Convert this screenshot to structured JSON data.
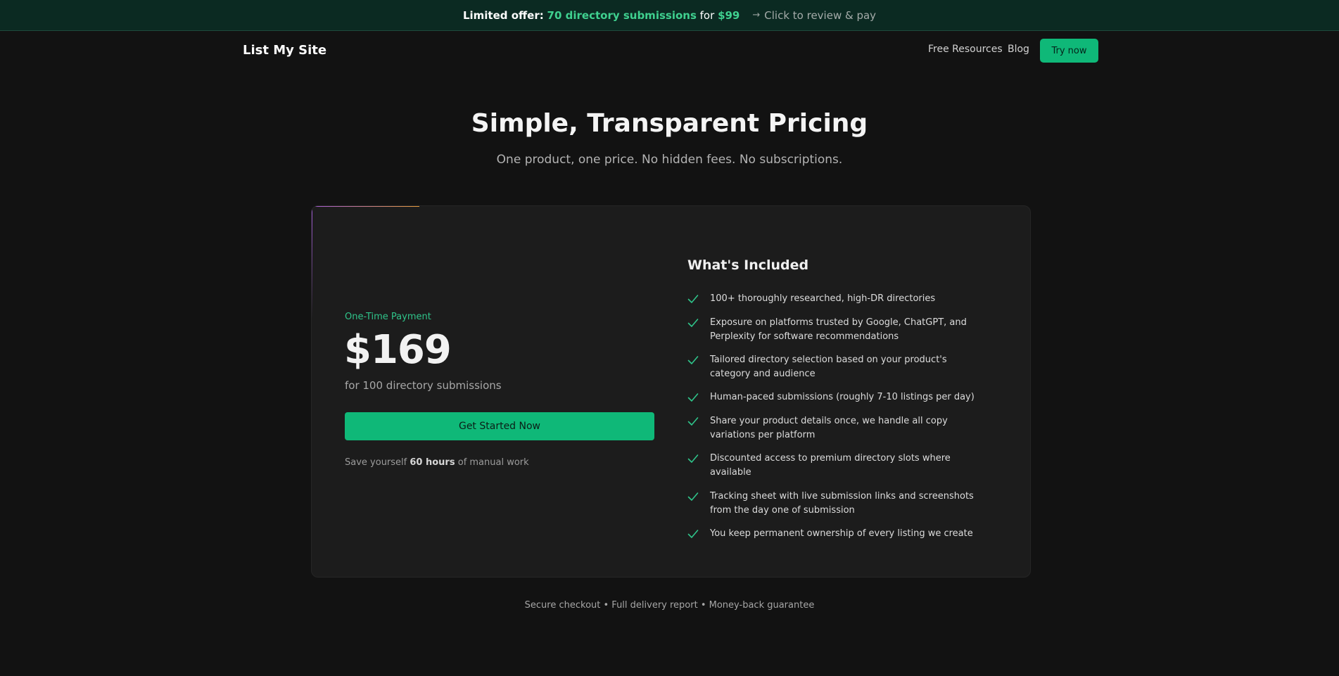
{
  "banner": {
    "prefix": "Limited offer:",
    "offer": "70 directory submissions",
    "for_word": "for",
    "price": "$99",
    "arrow": "→",
    "cta": "Click to review & pay"
  },
  "nav": {
    "logo": "List My Site",
    "links": [
      "Free Resources",
      "Blog"
    ],
    "cta": "Try now"
  },
  "hero": {
    "title": "Simple, Transparent Pricing",
    "subtitle": "One product, one price. No hidden fees. No subscriptions."
  },
  "pricing": {
    "label": "One-Time Payment",
    "price": "$169",
    "price_sub": "for 100 directory submissions",
    "button": "Get Started Now",
    "save_prefix": "Save yourself",
    "save_bold": "60 hours",
    "save_suffix": "of manual work"
  },
  "included": {
    "title": "What's Included",
    "items": [
      "100+ thoroughly researched, high-DR directories",
      "Exposure on platforms trusted by Google, ChatGPT, and Perplexity for software recommendations",
      "Tailored directory selection based on your product's category and audience",
      "Human-paced submissions (roughly 7-10 listings per day)",
      "Share your product details once, we handle all copy variations per platform",
      "Discounted access to premium directory slots where available",
      "Tracking sheet with live submission links and screenshots from the day one of submission",
      "You keep permanent ownership of every listing we create"
    ]
  },
  "footer": {
    "note": "Secure checkout • Full delivery report • Money-back guarantee"
  },
  "colors": {
    "accent_green": "#0fb878",
    "banner_bg": "#0b2a22",
    "page_bg": "#121212",
    "card_bg": "#1c1c1c",
    "check_green": "#2fc48a"
  },
  "icons": {
    "check": "check-icon",
    "arrow": "arrow-right-icon"
  }
}
